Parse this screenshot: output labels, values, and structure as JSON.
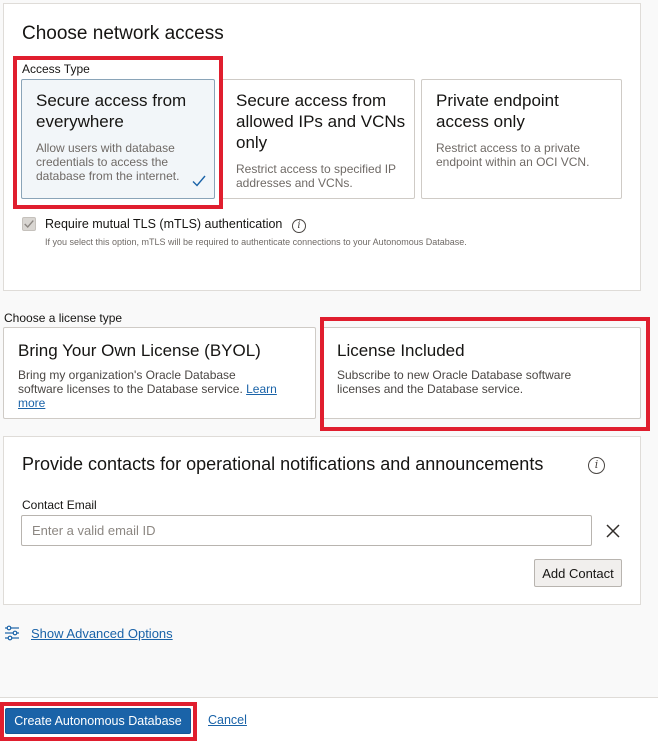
{
  "network": {
    "title": "Choose network access",
    "access_type_label": "Access Type",
    "options": [
      {
        "title": "Secure access from everywhere",
        "desc": "Allow users with database credentials to access the database from the internet.",
        "selected": true
      },
      {
        "title": "Secure access from allowed IPs and VCNs only",
        "desc": "Restrict access to specified IP addresses and VCNs.",
        "selected": false
      },
      {
        "title": "Private endpoint access only",
        "desc": "Restrict access to a private endpoint within an OCI VCN.",
        "selected": false
      }
    ],
    "mtls_label": "Require mutual TLS (mTLS) authentication",
    "mtls_checked": true,
    "mtls_help": "If you select this option, mTLS will be required to authenticate connections to your Autonomous Database."
  },
  "license": {
    "label": "Choose a license type",
    "options": [
      {
        "title": "Bring Your Own License (BYOL)",
        "desc": "Bring my organization's Oracle Database software licenses to the Database service.",
        "link": "Learn more",
        "selected": false
      },
      {
        "title": "License Included",
        "desc": "Subscribe to new Oracle Database software licenses and the Database service.",
        "selected": true
      }
    ]
  },
  "contacts": {
    "title": "Provide contacts for operational notifications and announcements",
    "email_label": "Contact Email",
    "email_placeholder": "Enter a valid email ID",
    "email_value": "",
    "add_button": "Add Contact"
  },
  "advanced": {
    "link": "Show Advanced Options"
  },
  "footer": {
    "create_button": "Create Autonomous Database",
    "cancel_link": "Cancel"
  },
  "colors": {
    "primary": "#1a63a8",
    "highlight": "#e01e2e",
    "selected_card_bg": "#f2f6f9"
  },
  "icons": [
    "checkmark-icon",
    "info-icon",
    "close-icon",
    "sliders-icon"
  ]
}
